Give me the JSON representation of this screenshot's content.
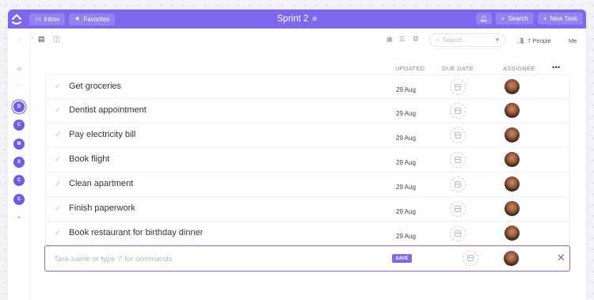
{
  "topbar": {
    "inbox_label": "Inbox",
    "favorites_label": "Favorites",
    "title": "Sprint 2",
    "search_label": "Search",
    "new_task_label": "New Task"
  },
  "sidebar": {
    "avatars": [
      "D",
      "C",
      "M",
      "S",
      "C",
      "C"
    ],
    "add_label": "+"
  },
  "toolbar": {
    "search_placeholder": "Search...",
    "people_label": "7 People",
    "me_label": "Me"
  },
  "columns": {
    "updated": "UPDATED",
    "due_date": "DUE DATE",
    "assignee": "ASSIGNEE",
    "more": "•••"
  },
  "tasks": [
    {
      "name": "Get groceries",
      "updated": "29 Aug"
    },
    {
      "name": "Dentist appointment",
      "updated": "29 Aug"
    },
    {
      "name": "Pay electricity bill",
      "updated": "29 Aug"
    },
    {
      "name": "Book flight",
      "updated": "29 Aug"
    },
    {
      "name": "Clean apartment",
      "updated": "29 Aug"
    },
    {
      "name": "Finish paperwork",
      "updated": "29 Aug"
    },
    {
      "name": "Book restaurant for birthday dinner",
      "updated": "29 Aug"
    }
  ],
  "new_task": {
    "placeholder": "Task name or type '/' for commands",
    "save_label": "SAVE"
  },
  "colors": {
    "accent": "#7b68ee"
  }
}
